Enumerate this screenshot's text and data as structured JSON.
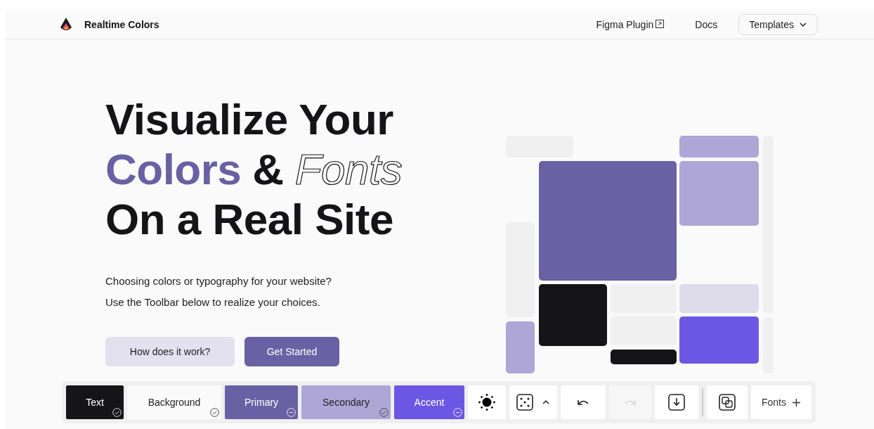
{
  "nav": {
    "brand": "Realtime Colors",
    "links": [
      {
        "label": "Figma Plugin",
        "external": true
      },
      {
        "label": "Docs",
        "external": false
      }
    ],
    "templates_button": "Templates"
  },
  "hero": {
    "line_1": "Visualize Your",
    "line_2_highlight": "Colors",
    "line_2_amp": "&",
    "line_2_outline": "Fonts",
    "line_3": "On a Real Site",
    "paragraphs": [
      "Choosing colors or typography for your website?",
      "Use the Toolbar below to realize your choices."
    ],
    "buttons": [
      {
        "label": "How does it work?",
        "kind": "secondary"
      },
      {
        "label": "Get Started",
        "kind": "primary"
      }
    ]
  },
  "toolbar": {
    "swatches": [
      {
        "label": "Text",
        "color": "#151517",
        "inverse": true,
        "kind": "check"
      },
      {
        "label": "Background",
        "color": "#fafafa",
        "inverse": false,
        "kind": "check"
      },
      {
        "label": "Primary",
        "color": "#6961a3",
        "inverse": true,
        "kind": "minus"
      },
      {
        "label": "Secondary",
        "color": "#aea6d6",
        "inverse": false,
        "kind": "check"
      },
      {
        "label": "Accent",
        "color": "#6c57e5",
        "inverse": true,
        "kind": "minus"
      }
    ],
    "tools": [
      {
        "kind": "theme",
        "disabled": false
      },
      {
        "kind": "randomize",
        "disabled": false
      },
      {
        "kind": "undo",
        "disabled": false
      },
      {
        "kind": "redo",
        "disabled": true
      },
      {
        "kind": "export",
        "disabled": false
      },
      {
        "kind": "share",
        "disabled": false
      }
    ],
    "fonts_button": "Fonts"
  }
}
